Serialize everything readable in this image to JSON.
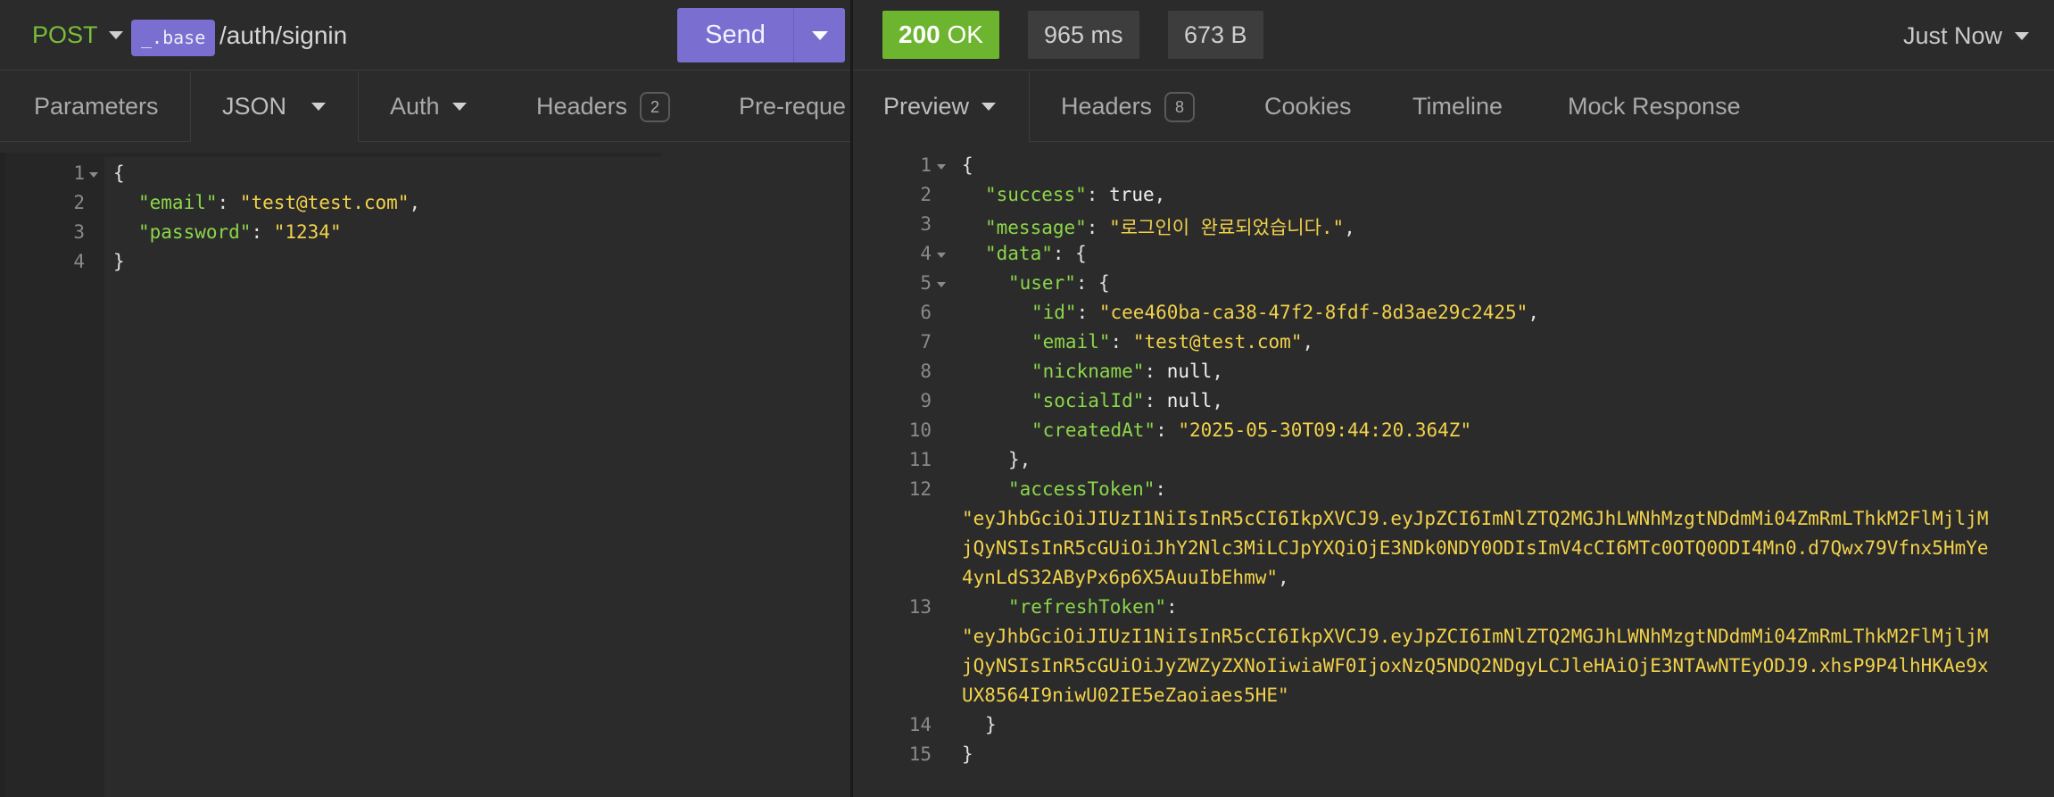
{
  "request": {
    "method": "POST",
    "env_tag": "_.base",
    "path": "/auth/signin",
    "send_label": "Send",
    "tabs": [
      {
        "label": "Parameters"
      },
      {
        "label": "JSON"
      },
      {
        "label": "Auth"
      },
      {
        "label": "Headers",
        "badge": "2"
      },
      {
        "label": "Pre-reque"
      }
    ],
    "body_lines": [
      {
        "n": "1",
        "text": "{"
      },
      {
        "n": "2",
        "key": "\"email\"",
        "value": "\"test@test.com\"",
        "tail": ","
      },
      {
        "n": "3",
        "key": "\"password\"",
        "value": "\"1234\"",
        "tail": ""
      },
      {
        "n": "4",
        "text": "}"
      }
    ]
  },
  "response": {
    "status_code": "200",
    "status_text": "OK",
    "time": "965 ms",
    "size": "673 B",
    "timestamp": "Just Now",
    "tabs": [
      {
        "label": "Preview"
      },
      {
        "label": "Headers",
        "badge": "8"
      },
      {
        "label": "Cookies"
      },
      {
        "label": "Timeline"
      },
      {
        "label": "Mock Response"
      }
    ],
    "lines": {
      "l1": "{",
      "success_key": "\"success\"",
      "success_val": "true",
      "message_key": "\"message\"",
      "message_val": "\"로그인이 완료되었습니다.\"",
      "data_key": "\"data\"",
      "user_key": "\"user\"",
      "id_key": "\"id\"",
      "id_val": "\"cee460ba-ca38-47f2-8fdf-8d3ae29c2425\"",
      "email_key": "\"email\"",
      "email_val": "\"test@test.com\"",
      "nickname_key": "\"nickname\"",
      "nickname_val": "null",
      "socialId_key": "\"socialId\"",
      "socialId_val": "null",
      "createdAt_key": "\"createdAt\"",
      "createdAt_val": "\"2025-05-30T09:44:20.364Z\"",
      "close_user": "},",
      "access_key": "\"accessToken\"",
      "access_val_1": "\"eyJhbGciOiJIUzI1NiIsInR5cCI6IkpXVCJ9.eyJpZCI6ImNlZTQ2MGJhLWNhMzgtNDdmMi04ZmRmLThkM2FlMjljM",
      "access_val_2": "jQyNSIsInR5cGUiOiJhY2Nlc3MiLCJpYXQiOjE3NDk0NDY0ODIsImV4cCI6MTc0OTQ0ODI4Mn0.d7Qwx79Vfnx5HmYe",
      "access_val_3": "4ynLdS32AByPx6p6X5AuuIbEhmw\"",
      "refresh_key": "\"refreshToken\"",
      "refresh_val_1": "\"eyJhbGciOiJIUzI1NiIsInR5cCI6IkpXVCJ9.eyJpZCI6ImNlZTQ2MGJhLWNhMzgtNDdmMi04ZmRmLThkM2FlMjljM",
      "refresh_val_2": "jQyNSIsInR5cGUiOiJyZWZyZXNoIiwiaWF0IjoxNzQ5NDQ2NDgyLCJleHAiOjE3NTAwNTEyODJ9.xhsP9P4lhHKAe9x",
      "refresh_val_3": "UX8564I9niwU02IE5eZaoiaes5HE\"",
      "close_data": "}",
      "close_root": "}"
    }
  },
  "colors": {
    "accent": "#7a6fd0",
    "method_green": "#79bf3b",
    "status_green": "#6db52f",
    "json_key": "#8bd64a",
    "json_string": "#f2d24b"
  },
  "icons": [
    "caret-down-icon",
    "fold-arrow-icon"
  ]
}
